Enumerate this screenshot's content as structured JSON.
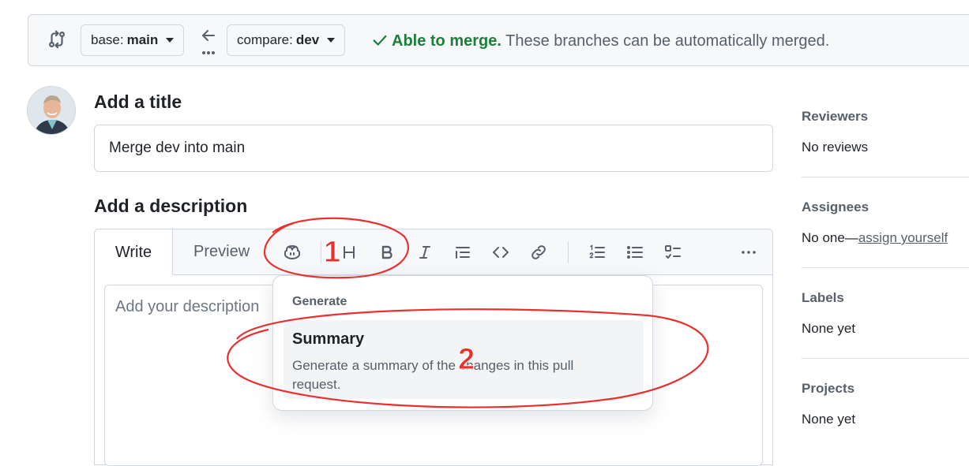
{
  "compare_bar": {
    "base_prefix": "base:",
    "base_branch": "main",
    "compare_prefix": "compare:",
    "compare_branch": "dev",
    "merge_ok": "Able to merge.",
    "merge_msg": "These branches can be automatically merged."
  },
  "title_section": {
    "heading": "Add a title",
    "value": "Merge dev into main"
  },
  "description_section": {
    "heading": "Add a description",
    "tabs": [
      "Write",
      "Preview"
    ],
    "placeholder": "Add your description"
  },
  "generate_menu": {
    "group_label": "Generate",
    "item_title": "Summary",
    "item_desc": "Generate a summary of the changes in this pull request."
  },
  "sidebar": {
    "reviewers_title": "Reviewers",
    "reviewers_value": "No reviews",
    "assignees_title": "Assignees",
    "assignees_value": "No one—",
    "assignees_link": "assign yourself",
    "labels_title": "Labels",
    "labels_value": "None yet",
    "projects_title": "Projects",
    "projects_value": "None yet"
  },
  "annotations": {
    "marker_1": "1",
    "marker_2": "2",
    "color": "#e8312f"
  },
  "colors": {
    "success": "#1a7f37",
    "border": "#d0d7de",
    "muted": "#57606a"
  },
  "icons": [
    "compare-arrows-icon",
    "left-arrow-icon",
    "check-icon",
    "copilot-icon",
    "heading-icon",
    "bold-icon",
    "italic-icon",
    "quote-icon",
    "code-icon",
    "link-icon",
    "ordered-list-icon",
    "unordered-list-icon",
    "task-list-icon",
    "more-icon"
  ]
}
